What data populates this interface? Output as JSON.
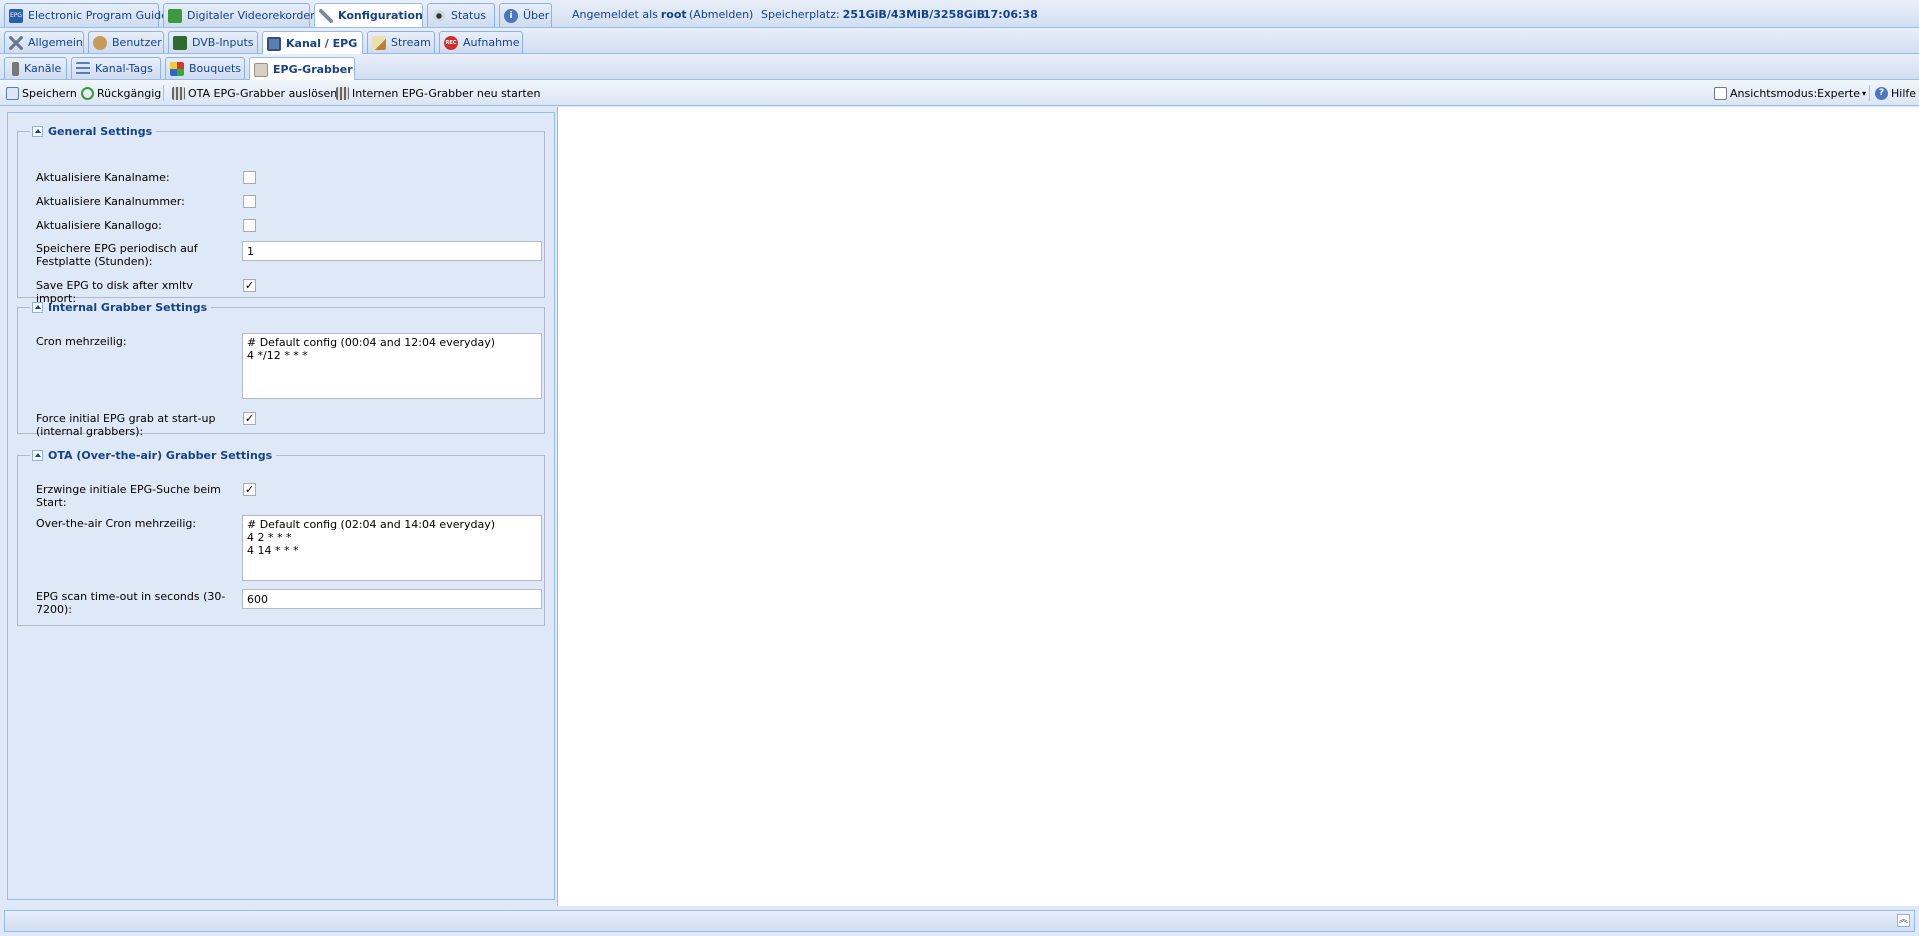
{
  "top_tabs": [
    {
      "label": "Electronic Program Guide",
      "icon": "epg-icon",
      "active": false
    },
    {
      "label": "Digitaler Videorekorder",
      "icon": "download-icon",
      "active": false
    },
    {
      "label": "Konfiguration",
      "icon": "wrench-icon",
      "active": true
    },
    {
      "label": "Status",
      "icon": "eye-icon",
      "active": false
    },
    {
      "label": "Über",
      "icon": "info-icon",
      "active": false
    }
  ],
  "header_info": {
    "logged_in_prefix": "Angemeldet als",
    "user": "root",
    "logout": "(Abmelden)",
    "storage_prefix": "Speicherplatz:",
    "storage": "251GiB/43MiB/3258GiB",
    "time": "17:06:38"
  },
  "config_tabs": [
    {
      "label": "Allgemein",
      "icon": "tools-icon",
      "active": false
    },
    {
      "label": "Benutzer",
      "icon": "users-icon",
      "active": false
    },
    {
      "label": "DVB-Inputs",
      "icon": "card-icon",
      "active": false
    },
    {
      "label": "Kanal / EPG",
      "icon": "tv-icon",
      "active": true
    },
    {
      "label": "Stream",
      "icon": "edit-icon",
      "active": false
    },
    {
      "label": "Aufnahme",
      "icon": "rec-icon",
      "active": false
    }
  ],
  "channel_tabs": [
    {
      "label": "Kanäle",
      "icon": "remote-icon",
      "active": false
    },
    {
      "label": "Kanal-Tags",
      "icon": "tags-icon",
      "active": false
    },
    {
      "label": "Bouquets",
      "icon": "grid-icon",
      "active": false
    },
    {
      "label": "EPG-Grabber",
      "icon": "grabber-icon",
      "active": true
    }
  ],
  "toolbar": {
    "save": "Speichern",
    "undo": "Rückgängig",
    "ota_trigger": "OTA EPG-Grabber auslösen",
    "restart_internal": "Internen EPG-Grabber neu starten",
    "view_mode": "Ansichtsmodus:Experte",
    "help": "Hilfe"
  },
  "general": {
    "title": "General Settings",
    "update_name_label": "Aktualisiere Kanalname:",
    "update_number_label": "Aktualisiere Kanalnummer:",
    "update_logo_label": "Aktualisiere Kanallogo:",
    "save_period_label": "Speichere EPG periodisch auf Festplatte (Stunden):",
    "save_period_value": "1",
    "save_after_xmltv_label": "Save EPG to disk after xmltv import:",
    "update_name_checked": false,
    "update_number_checked": false,
    "update_logo_checked": false,
    "save_after_xmltv_checked": true
  },
  "internal": {
    "title": "Internal Grabber Settings",
    "cron_label": "Cron mehrzeilig:",
    "cron_value": "# Default config (00:04 and 12:04 everyday)\n4 */12 * * *",
    "force_label": "Force initial EPG grab at start-up (internal grabbers):",
    "force_checked": true
  },
  "ota": {
    "title": "OTA (Over-the-air) Grabber Settings",
    "force_label": "Erzwinge initiale EPG-Suche beim Start:",
    "force_checked": true,
    "cron_label": "Over-the-air Cron mehrzeilig:",
    "cron_value": "# Default config (02:04 and 14:04 everyday)\n4 2 * * *\n4 14 * * *",
    "timeout_label": "EPG scan time-out in seconds (30-7200):",
    "timeout_value": "600"
  },
  "colors": {
    "accent": "#15428b",
    "panel_bg": "#dfe8f6",
    "border": "#99bbe8"
  }
}
